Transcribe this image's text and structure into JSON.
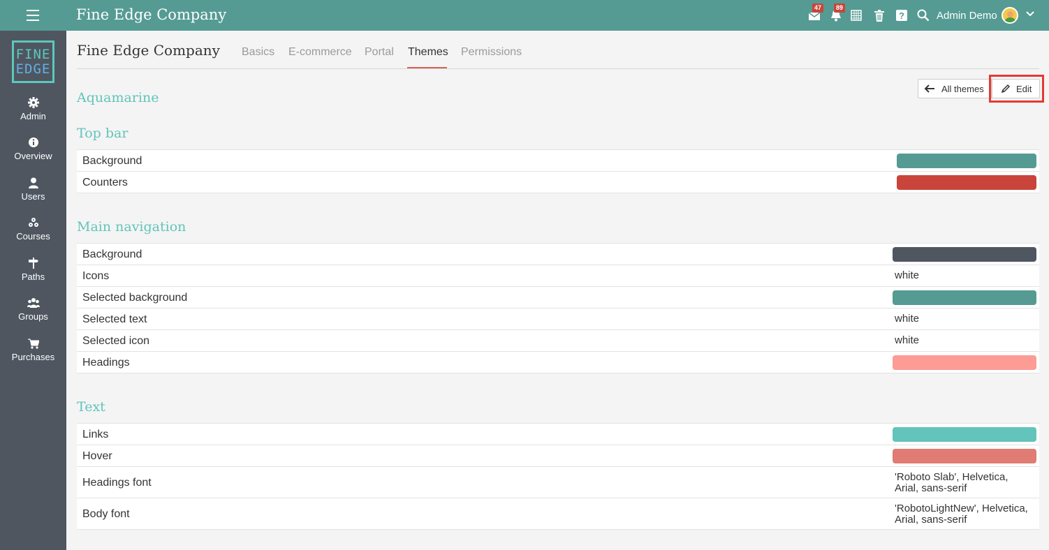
{
  "topbar": {
    "app_title": "Fine Edge Company",
    "messages_count": "47",
    "notifications_count": "89",
    "user_name": "Admin Demo",
    "bg_color": "#559b93"
  },
  "sidebar": {
    "logo_line1": "FINE",
    "logo_line2": "EDGE",
    "items": [
      {
        "label": "Admin",
        "icon": "gear-icon"
      },
      {
        "label": "Overview",
        "icon": "info-icon"
      },
      {
        "label": "Users",
        "icon": "user-icon"
      },
      {
        "label": "Courses",
        "icon": "courses-icon"
      },
      {
        "label": "Paths",
        "icon": "signpost-icon"
      },
      {
        "label": "Groups",
        "icon": "group-icon"
      },
      {
        "label": "Purchases",
        "icon": "cart-icon"
      }
    ]
  },
  "page": {
    "title": "Fine Edge Company",
    "tabs": [
      {
        "label": "Basics"
      },
      {
        "label": "E-commerce"
      },
      {
        "label": "Portal"
      },
      {
        "label": "Themes"
      },
      {
        "label": "Permissions"
      }
    ],
    "active_tab": "Themes",
    "all_themes_label": "All themes",
    "edit_label": "Edit",
    "theme_name": "Aquamarine"
  },
  "sections": {
    "top_bar": {
      "title": "Top bar",
      "rows": [
        {
          "label": "Background",
          "color": "#559b93"
        },
        {
          "label": "Counters",
          "color": "#c9443a"
        }
      ]
    },
    "main_navigation": {
      "title": "Main navigation",
      "rows": [
        {
          "label": "Background",
          "color": "#4f5660"
        },
        {
          "label": "Icons",
          "value": "white"
        },
        {
          "label": "Selected background",
          "color": "#559b93"
        },
        {
          "label": "Selected text",
          "value": "white"
        },
        {
          "label": "Selected icon",
          "value": "white"
        },
        {
          "label": "Headings",
          "color": "#fc9c94"
        }
      ]
    },
    "text": {
      "title": "Text",
      "rows": [
        {
          "label": "Links",
          "color": "#62c4bb"
        },
        {
          "label": "Hover",
          "color": "#e07c74"
        },
        {
          "label": "Headings font",
          "value_line1": "'Roboto Slab', Helvetica,",
          "value_line2": "Arial, sans-serif"
        },
        {
          "label": "Body font",
          "value_line1": "'RobotoLightNew', Helvetica,",
          "value_line2": "Arial, sans-serif"
        }
      ]
    }
  }
}
